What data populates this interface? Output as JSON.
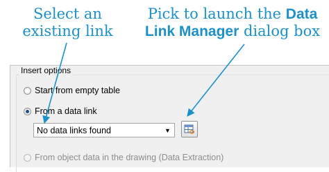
{
  "callouts": {
    "left": "Select an existing link",
    "right_prefix": "Pick to launch the ",
    "right_bold": "Data Link Manager",
    "right_suffix": " dialog box"
  },
  "insert_options": {
    "legend": "Insert options",
    "start_empty": "Start from empty table",
    "from_data_link": "From a data link",
    "select_value": "No data links found",
    "from_object_data": "From object data in the drawing (Data Extraction)"
  },
  "colors": {
    "callout": "#1e90c8",
    "radio_dot": "#1d4f8a"
  },
  "icons": {
    "launch_button": "data-link-manager-icon",
    "select_arrow": "chevron-down-icon"
  },
  "state": {
    "selected_option": "from_data_link",
    "disabled_options": [
      "from_object_data"
    ]
  }
}
